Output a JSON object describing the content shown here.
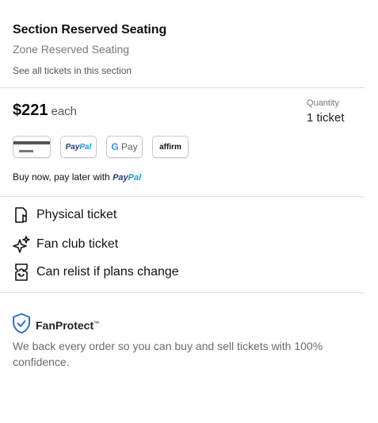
{
  "listing": {
    "section_title": "Section Reserved Seating",
    "zone": "Zone Reserved Seating",
    "see_all_link": "See all tickets in this section"
  },
  "price": {
    "amount": "$221",
    "unit": "each"
  },
  "quantity": {
    "label": "Quantity",
    "value": "1 ticket"
  },
  "payment_methods": [
    {
      "name": "card",
      "icon": "credit-card-icon"
    },
    {
      "name": "paypal",
      "label_a": "Pay",
      "label_b": "Pal",
      "icon": "paypal-logo"
    },
    {
      "name": "google-pay",
      "label_g": "G",
      "label_pay": " Pay",
      "icon": "google-pay-logo"
    },
    {
      "name": "affirm",
      "label": "affirm",
      "icon": "affirm-logo"
    }
  ],
  "bnpl": {
    "text": "Buy now, pay later with",
    "brand_a": "Pay",
    "brand_b": "Pal"
  },
  "features": [
    {
      "label": "Physical ticket",
      "icon": "physical-ticket-icon"
    },
    {
      "label": "Fan club ticket",
      "icon": "sparkle-icon"
    },
    {
      "label": "Can relist if plans change",
      "icon": "relist-ticket-icon"
    }
  ],
  "fan_protect": {
    "title": "FanProtect",
    "mark": "™",
    "description": "We back every order so you can buy and sell tickets with 100% confidence.",
    "icon": "shield-check-icon",
    "accent": "#2d6fd2"
  },
  "colors": {
    "paypal_dark": "#253b80",
    "paypal_light": "#179bd7",
    "divider": "#dcdcdc"
  }
}
